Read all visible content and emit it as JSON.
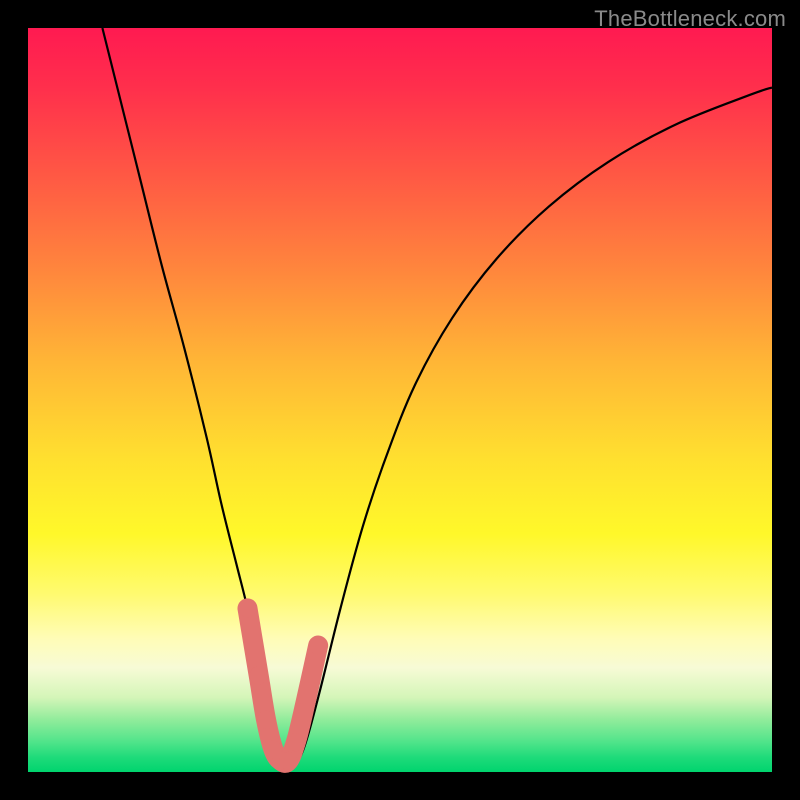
{
  "watermark": "TheBottleneck.com",
  "colors": {
    "page_bg": "#000000",
    "gradient_top": "#ff1a51",
    "gradient_bottom": "#00d46e",
    "curve": "#000000",
    "marker_fill": "#e2736f",
    "marker_stroke": "#e2736f"
  },
  "chart_data": {
    "type": "line",
    "title": "",
    "xlabel": "",
    "ylabel": "",
    "xlim": [
      0,
      100
    ],
    "ylim": [
      0,
      100
    ],
    "grid": false,
    "curve": {
      "x": [
        10,
        12,
        15,
        18,
        21,
        24,
        26,
        28,
        29.5,
        31,
        32.5,
        34,
        35.5,
        37,
        39,
        42,
        45,
        48,
        52,
        57,
        63,
        70,
        78,
        87,
        97,
        100
      ],
      "y": [
        100,
        92,
        80,
        68,
        57,
        45,
        36,
        28,
        22,
        15,
        8,
        3,
        1,
        3,
        10,
        22,
        33,
        42,
        52,
        61,
        69,
        76,
        82,
        87,
        91,
        92
      ]
    },
    "markers": {
      "x": [
        29.5,
        31,
        32,
        33,
        34,
        35,
        36,
        37,
        39
      ],
      "y": [
        22,
        13,
        7,
        3,
        1.5,
        1.5,
        4,
        8,
        17
      ]
    },
    "marker_style": {
      "shape": "circle",
      "radius_px": 9,
      "stroke_width_px": 10,
      "capsule": true
    }
  }
}
